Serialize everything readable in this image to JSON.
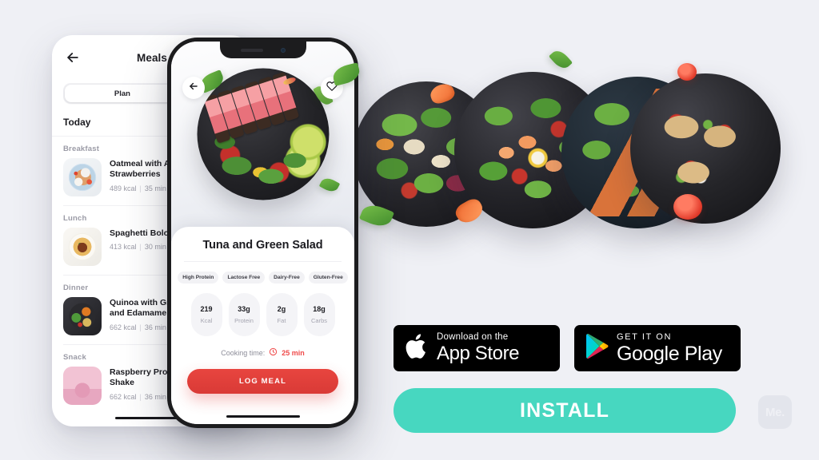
{
  "background_color": "#eff0f5",
  "accent_colors": {
    "install_teal": "#47d7c0",
    "log_meal_red": "#e0433d",
    "cooking_time_red": "#ef4a4a",
    "badge_black": "#000000"
  },
  "meal_list_phone": {
    "header": {
      "back_icon": "arrow-left-icon",
      "title": "Meals"
    },
    "segmented_control": {
      "selected": "Plan"
    },
    "day_label": "Today",
    "groups": [
      {
        "label": "Breakfast",
        "items": [
          {
            "name": "Oatmeal with Almonds and\nStrawberries",
            "calories": "489 kcal",
            "time": "35 min",
            "thumb": "oatmeal-thumb"
          }
        ]
      },
      {
        "label": "Lunch",
        "items": [
          {
            "name": "Spaghetti Bolognese",
            "calories": "413 kcal",
            "time": "30 min",
            "thumb": "spaghetti-thumb"
          }
        ]
      },
      {
        "label": "Dinner",
        "items": [
          {
            "name": "Quinoa with Grilled Vegetables\nand Edamame Beans",
            "calories": "662 kcal",
            "time": "36 min",
            "thumb": "quinoa-thumb"
          }
        ]
      },
      {
        "label": "Snack",
        "items": [
          {
            "name": "Raspberry Protein\nShake",
            "calories": "662 kcal",
            "time": "36 min",
            "thumb": "shake-thumb"
          }
        ]
      }
    ]
  },
  "detail_phone": {
    "back_icon": "arrow-left-icon",
    "favorite_icon": "heart-icon",
    "dish_title": "Tuna and Green Salad",
    "tags": [
      "High Protein",
      "Lactose Free",
      "Dairy-Free",
      "Gluten-Free"
    ],
    "nutrition": [
      {
        "value": "219",
        "label": "Kcal"
      },
      {
        "value": "33g",
        "label": "Protein"
      },
      {
        "value": "2g",
        "label": "Fat"
      },
      {
        "value": "18g",
        "label": "Carbs"
      }
    ],
    "cooking_time": {
      "label": "Cooking time:",
      "icon": "clock-icon",
      "value": "25 min"
    },
    "primary_button": "LOG MEAL"
  },
  "food_bowls": [
    {
      "name": "chicken-avocado-salad-bowl"
    },
    {
      "name": "shrimp-egg-salad-bowl"
    },
    {
      "name": "salmon-green-salad-bowl"
    },
    {
      "name": "bruschetta-plate"
    }
  ],
  "store_badges": {
    "app_store": {
      "icon": "apple-icon",
      "small": "Download on the",
      "big": "App Store"
    },
    "google_play": {
      "icon": "google-play-icon",
      "small": "GET IT ON",
      "big": "Google Play"
    }
  },
  "install_button": "INSTALL",
  "watermark": "Me."
}
